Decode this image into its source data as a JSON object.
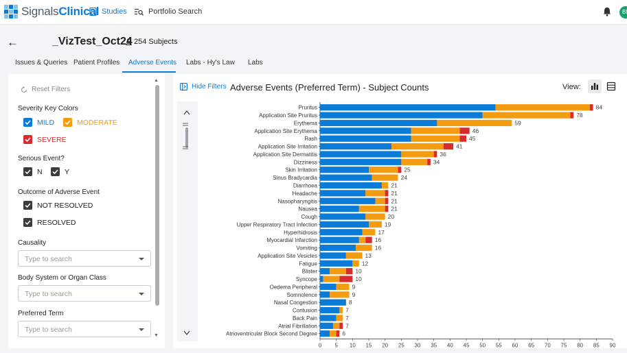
{
  "app": {
    "brand_prefix": "Signals",
    "brand_suffix": "Clinical",
    "nav": [
      {
        "label": "Studies",
        "icon": "book-icon"
      },
      {
        "label": "Portfolio Search",
        "icon": "list-search-icon"
      }
    ],
    "user_initials": "BN"
  },
  "study": {
    "title": "_VizTest_Oct24",
    "subjects": "254 Subjects"
  },
  "tabs": [
    {
      "label": "Issues & Queries"
    },
    {
      "label": "Patient Profiles"
    },
    {
      "label": "Adverse Events",
      "active": true
    },
    {
      "label": "Labs - Hy's Law"
    },
    {
      "label": "Labs"
    }
  ],
  "filters": {
    "reset_label": "Reset Filters",
    "severity": {
      "title": "Severity Key Colors",
      "options": [
        {
          "label": "MILD",
          "color": "#0a7bd6",
          "checked": true
        },
        {
          "label": "MODERATE",
          "color": "#f39c12",
          "checked": true
        },
        {
          "label": "SEVERE",
          "color": "#d62c2c",
          "checked": true
        }
      ]
    },
    "serious": {
      "title": "Serious Event?",
      "options": [
        {
          "label": "N",
          "checked": true
        },
        {
          "label": "Y",
          "checked": true
        }
      ]
    },
    "outcome": {
      "title": "Outcome of Adverse Event",
      "options": [
        {
          "label": "NOT RESOLVED",
          "checked": true
        },
        {
          "label": "RESOLVED",
          "checked": true
        }
      ]
    },
    "causality": {
      "title": "Causality",
      "placeholder": "Type to search"
    },
    "body_system": {
      "title": "Body System or Organ Class",
      "placeholder": "Type to search"
    },
    "preferred_term": {
      "title": "Preferred Term",
      "placeholder": "Type to search"
    }
  },
  "panel": {
    "hide_filters_label": "Hide Filters",
    "title": "Adverse Events (Preferred Term) - Subject Counts",
    "view_label": "View:",
    "views": [
      {
        "icon": "bar-chart-icon",
        "active": true
      },
      {
        "icon": "table-icon",
        "active": false
      }
    ]
  },
  "colors": {
    "mild": "#0a7bd6",
    "moderate": "#f39c12",
    "severe": "#d62c2c",
    "accent": "#0a7bd6"
  },
  "chart_data": {
    "type": "bar",
    "orientation": "horizontal",
    "stacked": true,
    "xlim": [
      0,
      90
    ],
    "xticks": [
      0,
      5,
      10,
      15,
      20,
      25,
      30,
      35,
      40,
      45,
      50,
      55,
      60,
      65,
      70,
      75,
      80,
      85,
      90
    ],
    "categories": [
      "Pruritus",
      "Application Site Pruritus",
      "Erythema",
      "Application Site Erythema",
      "Rash",
      "Application Site Irritation",
      "Application Site Dermatitis",
      "Dizziness",
      "Skin Irritation",
      "Sinus Bradycardia",
      "Diarrhoea",
      "Headache",
      "Nasopharyngitis",
      "Nausea",
      "Cough",
      "Upper Respiratory Tract Infection",
      "Hyperhidrosis",
      "Myocardial Infarction",
      "Vomiting",
      "Application Site Vesicles",
      "Fatigue",
      "Blister",
      "Syncope",
      "Oedema Peripheral",
      "Somnolence",
      "Nasal Congestion",
      "Contusion",
      "Back Pain",
      "Atrial Fibrillation",
      "Atrioventricular Block Second Degree"
    ],
    "series": [
      {
        "key": "mild",
        "values": [
          54,
          50,
          36,
          28,
          28,
          22,
          25,
          25,
          15,
          16,
          19,
          14,
          17,
          12,
          14,
          15,
          13,
          12,
          11,
          8,
          10,
          3,
          1,
          5,
          3,
          8,
          6,
          5,
          4,
          3
        ]
      },
      {
        "key": "moderate",
        "values": [
          29,
          27,
          23,
          15,
          15,
          16,
          10,
          8,
          9,
          8,
          2,
          6,
          3,
          8,
          6,
          4,
          4,
          2,
          5,
          5,
          2,
          5,
          5,
          4,
          6,
          0,
          1,
          2,
          2,
          2
        ]
      },
      {
        "key": "severe",
        "values": [
          1,
          1,
          0,
          3,
          2,
          3,
          1,
          1,
          1,
          0,
          0,
          1,
          1,
          1,
          0,
          0,
          0,
          2,
          0,
          0,
          0,
          2,
          4,
          0,
          0,
          0,
          0,
          0,
          1,
          1
        ]
      }
    ],
    "totals": [
      84,
      78,
      59,
      46,
      45,
      41,
      36,
      34,
      25,
      24,
      21,
      21,
      21,
      21,
      20,
      19,
      17,
      16,
      16,
      13,
      12,
      10,
      10,
      9,
      9,
      8,
      7,
      7,
      7,
      6
    ]
  }
}
